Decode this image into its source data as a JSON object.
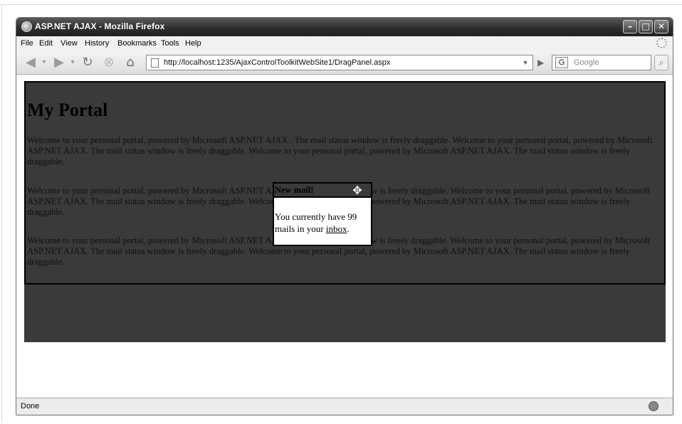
{
  "window": {
    "title": "ASP.NET AJAX - Mozilla Firefox",
    "buttons": {
      "minimize": "–",
      "maximize": "□",
      "close": "✕"
    }
  },
  "menu": {
    "items": [
      {
        "label": "File"
      },
      {
        "label": "Edit"
      },
      {
        "label": "View"
      },
      {
        "label": "History"
      },
      {
        "label": "Bookmarks"
      },
      {
        "label": "Tools"
      },
      {
        "label": "Help"
      }
    ]
  },
  "navigation": {
    "back_icon": "back-arrow-icon",
    "forward_icon": "forward-arrow-icon",
    "reload_icon": "reload-icon",
    "stop_icon": "stop-icon",
    "home_icon": "home-icon",
    "url": "http://localhost:1235/AjaxControlToolkitWebSite1/DragPanel.aspx",
    "search_placeholder": "Google",
    "search_engine_letter": "G"
  },
  "page": {
    "heading": "My Portal",
    "paragraphs": [
      "Welcome to your personal portal, powered by Microsoft ASP.NET AJAX . The mail status window is freely draggable. Welcome to your personal portal, powered by Microsoft ASP.NET AJAX. The mail status window is freely draggable. Welcome to your personal portal, powered by Microsoft ASP.NET AJAX. The mail status window is freely draggable.",
      "Welcome to your personal portal, powered by Microsoft ASP.NET AJAX. The mail status window is freely draggable. Welcome to your personal portal, powered by Microsoft ASP.NET AJAX. The mail status window is freely draggable. Welcome to your personal portal, powered by Microsoft ASP.NET AJAX. The mail status window is freely draggable.",
      "Welcome to your personal portal, powered by Microsoft ASP.NET AJAX. The mail status window is freely draggable. Welcome to your personal portal, powered by Microsoft ASP.NET AJAX. The mail status window is freely draggable. Welcome to your personal portal, powered by Microsoft ASP.NET AJAX. The mail status window is freely draggable."
    ]
  },
  "mail_panel": {
    "title": "New mail!",
    "text_before_link": "You currently have 99 mails in your ",
    "link_text": "inbox",
    "text_after_link": "."
  },
  "status": {
    "text": "Done"
  },
  "colors": {
    "page_background": "#3a3a3a",
    "titlebar": "#2e2e2e",
    "panel_border": "#000000"
  }
}
